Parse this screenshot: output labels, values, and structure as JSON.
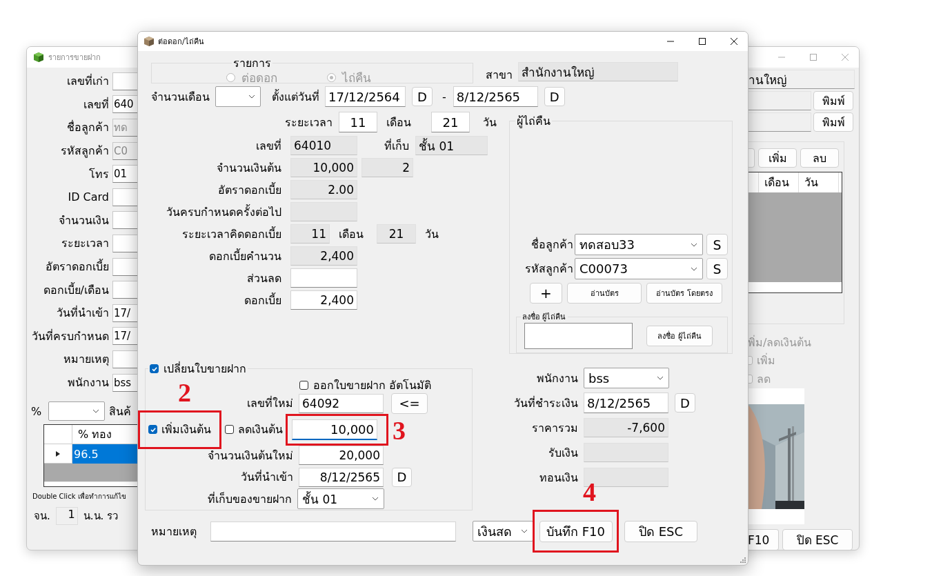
{
  "background_window": {
    "title": "รายการขายฝาก",
    "fields": [
      {
        "label": "เลขที่เก่า",
        "disabled": false
      },
      {
        "label": "เลขที่",
        "value": "640",
        "disabled": false
      },
      {
        "label": "ชื่อลูกค้า",
        "value": "ทด",
        "disabled": true
      },
      {
        "label": "รหัสลูกค้า",
        "value": "C0",
        "disabled": true
      },
      {
        "label": "โทร",
        "value": "01",
        "disabled": false
      },
      {
        "label": "ID Card",
        "disabled": false
      },
      {
        "label": "จำนวนเงิน",
        "disabled": false
      },
      {
        "label": "ระยะเวลา",
        "disabled": false
      },
      {
        "label": "อัตราดอกเบี้ย",
        "disabled": false
      },
      {
        "label": "ดอกเบี้ย/เดือน",
        "disabled": false
      },
      {
        "label": "วันที่นำเข้า",
        "value": "17/",
        "disabled": false
      },
      {
        "label": "วันที่ครบกำหนด",
        "value": "17/",
        "disabled": false
      },
      {
        "label": "หมายเหตุ",
        "disabled": false
      },
      {
        "label": "พนักงาน",
        "value": "bss",
        "disabled": false
      }
    ],
    "percent_label": "%",
    "product_label": "สินค้",
    "grid": {
      "columns": [
        "% ทอง"
      ],
      "rows": [
        {
          "cells": [
            "96.5"
          ],
          "selected": true
        }
      ]
    },
    "hint": "Double Click เพื่อทำการแก้ไข",
    "count_label": "จน.",
    "count": "1",
    "weight_label": "น.น. รว",
    "branch": "านใหญ่",
    "print_buttons": [
      "พิมพ์",
      "พิมพ์"
    ],
    "item_buttons": [
      "เพิ่ม",
      "ลบ"
    ],
    "history_columns": [
      "เดือน",
      "วัน"
    ],
    "adjust_label": "พิ่ม/ลดเงินต้น",
    "adjust_options": [
      {
        "label": "เพิ่ม",
        "checked": false
      },
      {
        "label": "ลด",
        "checked": false
      }
    ],
    "buttons": [
      "F10",
      "ปิด ESC"
    ]
  },
  "dialog": {
    "title": "ต่อดอก/ไถ่คืน",
    "mode": {
      "label": "รายการ",
      "disabled": true,
      "options": [
        {
          "label": "ต่อดอก",
          "selected": false
        },
        {
          "label": "ไถ่คืน",
          "selected": true
        }
      ]
    },
    "branch": {
      "label": "สาขา",
      "value": "สำนักงานใหญ่"
    },
    "months": {
      "label": "จำนวนเดือน"
    },
    "from": {
      "label": "ตั้งแต่วันที่",
      "value": "17/12/2564",
      "button": "D"
    },
    "dash": "-",
    "to": {
      "value": "8/12/2565",
      "button": "D"
    },
    "duration": {
      "label": "ระยะเวลา",
      "months": "11",
      "months_unit": "เดือน",
      "days": "21",
      "days_unit": "วัน"
    },
    "details": [
      {
        "kind": "pair",
        "label": "เลขที่",
        "value": "64010",
        "label2": "ที่เก็บ",
        "value2": "ชั้น 01",
        "editable": false
      },
      {
        "kind": "pair",
        "label": "จำนวนเงินต้น",
        "value": "10,000",
        "value2": "2",
        "editable": false
      },
      {
        "kind": "field",
        "label": "อัตราดอกเบี้ย",
        "value": "2.00",
        "editable": false
      },
      {
        "kind": "field",
        "label": "วันครบกำหนดครั้งต่อไป",
        "editable": false
      },
      {
        "kind": "period",
        "label": "ระยะเวลาคิดดอกเบี้ย",
        "months": "11",
        "months_unit": "เดือน",
        "days": "21",
        "days_unit": "วัน",
        "editable": false
      },
      {
        "kind": "field",
        "label": "ดอกเบี้ยคำนวน",
        "value": "2,400",
        "editable": false
      },
      {
        "kind": "field",
        "label": "ส่วนลด",
        "editable": true
      },
      {
        "kind": "field",
        "label": "ดอกเบี้ย",
        "value": "2,400",
        "editable": true
      }
    ],
    "redeemer": {
      "label": "ผู้ไถ่คืน",
      "customers": [
        {
          "label": "ชื่อลูกค้า",
          "value": "ทดสอบ33",
          "button": "S"
        },
        {
          "label": "รหัสลูกค้า",
          "value": "C00073",
          "button": "S"
        }
      ],
      "buttons": [
        "+",
        "อ่านบัตร",
        "อ่านบัตร โดยตรง"
      ],
      "signature": {
        "label": "ลงชื่อ ผู้ไถ่คืน",
        "button": "ลงชื่อ ผู้ไถ่คืน"
      }
    },
    "renew": {
      "label": "เปลี่ยนใบขายฝาก",
      "checked": true,
      "auto_issue": {
        "label": "ออกใบขายฝาก อัตโนมัติ",
        "checked": false
      },
      "new_number": {
        "label": "เลขที่ใหม่",
        "value": "64092",
        "button": "<="
      },
      "add_principal": {
        "label": "เพิ่มเงินต้น",
        "checked": true,
        "highlighted": true,
        "marker": "2"
      },
      "reduce_principal": {
        "label": "ลดเงินต้น",
        "checked": false
      },
      "amount": {
        "value": "10,000",
        "focused": true,
        "highlighted": true,
        "marker": "3"
      },
      "new_principal": {
        "label": "จำนวนเงินต้นใหม่",
        "value": "20,000"
      },
      "import_date": {
        "label": "วันที่นำเข้า",
        "value": "8/12/2565",
        "button": "D"
      },
      "storage": {
        "label": "ที่เก็บของขายฝาก",
        "value": "ชั้น 01"
      }
    },
    "payment": [
      {
        "kind": "combo",
        "label": "พนักงาน",
        "value": "bss"
      },
      {
        "kind": "date",
        "label": "วันที่ชำระเงิน",
        "value": "8/12/2565",
        "button": "D"
      },
      {
        "kind": "readonly",
        "label": "ราคารวม",
        "value": "-7,600"
      },
      {
        "kind": "readonly",
        "label": "รับเงิน"
      },
      {
        "kind": "readonly",
        "label": "ทอนเงิน"
      }
    ],
    "note": {
      "label": "หมายเหตุ"
    },
    "method": "เงินสด",
    "save": {
      "label": "บันทึก F10",
      "highlighted": true,
      "marker": "4"
    },
    "close": {
      "label": "ปิด ESC"
    }
  }
}
